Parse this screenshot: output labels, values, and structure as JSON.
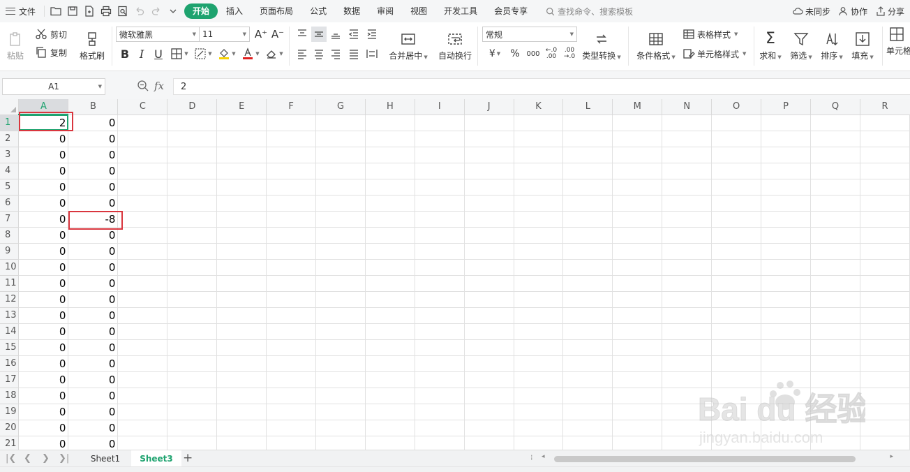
{
  "menubar": {
    "file_label": "文件",
    "tabs": [
      {
        "label": "开始",
        "active": true
      },
      {
        "label": "插入"
      },
      {
        "label": "页面布局"
      },
      {
        "label": "公式"
      },
      {
        "label": "数据"
      },
      {
        "label": "审阅"
      },
      {
        "label": "视图"
      },
      {
        "label": "开发工具"
      },
      {
        "label": "会员专享"
      }
    ],
    "search_placeholder": "查找命令、搜索模板",
    "sync_label": "未同步",
    "collab_label": "协作",
    "share_label": "分享"
  },
  "ribbon": {
    "paste": "粘贴",
    "cut": "剪切",
    "copy": "复制",
    "format_painter": "格式刷",
    "font_name": "微软雅黑",
    "font_size": "11",
    "merge_center": "合并居中",
    "wrap_text": "自动换行",
    "number_format": "常规",
    "type_convert": "类型转换",
    "conditional_format": "条件格式",
    "table_style": "表格样式",
    "cell_style": "单元格样式",
    "sum": "求和",
    "filter": "筛选",
    "sort": "排序",
    "fill": "填充",
    "cell": "单元格"
  },
  "formula_bar": {
    "name_box": "A1",
    "fx_label": "fx",
    "formula": "2"
  },
  "grid": {
    "columns": [
      "A",
      "B",
      "C",
      "D",
      "E",
      "F",
      "G",
      "H",
      "I",
      "J",
      "K",
      "L",
      "M",
      "N",
      "O",
      "P",
      "Q",
      "R"
    ],
    "rows": [
      {
        "num": "1",
        "a": "2",
        "b": "0"
      },
      {
        "num": "2",
        "a": "0",
        "b": "0"
      },
      {
        "num": "3",
        "a": "0",
        "b": "0"
      },
      {
        "num": "4",
        "a": "0",
        "b": "0"
      },
      {
        "num": "5",
        "a": "0",
        "b": "0"
      },
      {
        "num": "6",
        "a": "0",
        "b": "0"
      },
      {
        "num": "7",
        "a": "0",
        "b": "-8"
      },
      {
        "num": "8",
        "a": "0",
        "b": "0"
      },
      {
        "num": "9",
        "a": "0",
        "b": "0"
      },
      {
        "num": "10",
        "a": "0",
        "b": "0"
      },
      {
        "num": "11",
        "a": "0",
        "b": "0"
      },
      {
        "num": "12",
        "a": "0",
        "b": "0"
      },
      {
        "num": "13",
        "a": "0",
        "b": "0"
      },
      {
        "num": "14",
        "a": "0",
        "b": "0"
      },
      {
        "num": "15",
        "a": "0",
        "b": "0"
      },
      {
        "num": "16",
        "a": "0",
        "b": "0"
      },
      {
        "num": "17",
        "a": "0",
        "b": "0"
      },
      {
        "num": "18",
        "a": "0",
        "b": "0"
      },
      {
        "num": "19",
        "a": "0",
        "b": "0"
      },
      {
        "num": "20",
        "a": "0",
        "b": "0"
      },
      {
        "num": "21",
        "a": "0",
        "b": "0"
      }
    ]
  },
  "sheets": {
    "tabs": [
      {
        "label": "Sheet1",
        "active": false
      },
      {
        "label": "Sheet3",
        "active": true
      }
    ]
  },
  "watermark": {
    "brand": "Bai du 经验",
    "url": "jingyan.baidu.com"
  },
  "colors": {
    "accent": "#1ea36f",
    "highlight": "#d9363e"
  }
}
